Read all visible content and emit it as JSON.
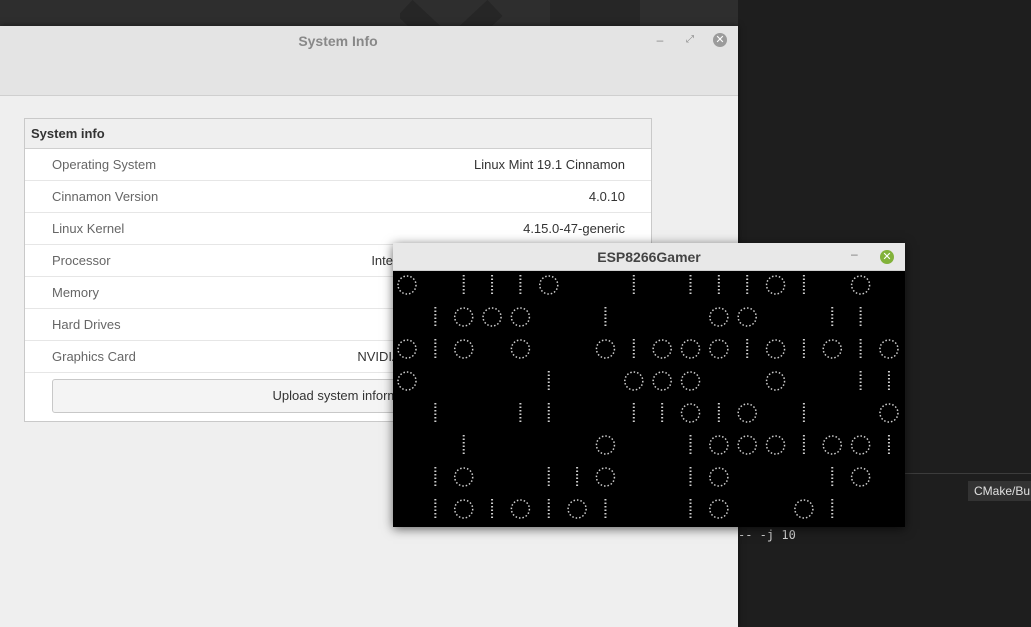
{
  "system_info_window": {
    "title": "System Info",
    "panel_header": "System info",
    "rows": [
      {
        "label": "Operating System",
        "value": "Linux Mint 19.1 Cinnamon"
      },
      {
        "label": "Cinnamon Version",
        "value": "4.0.10"
      },
      {
        "label": "Linux Kernel",
        "value": "4.15.0-47-generic"
      },
      {
        "label": "Processor",
        "value": "Inte"
      },
      {
        "label": "Memory",
        "value": ""
      },
      {
        "label": "Hard Drives",
        "value": ""
      },
      {
        "label": "Graphics Card",
        "value": "NVIDIA C"
      }
    ],
    "upload_button": "Upload system informa",
    "controls": {
      "minimize": "–",
      "maximize": "⤢",
      "close": "✕"
    }
  },
  "esp_window": {
    "title": "ESP8266Gamer",
    "controls": {
      "minimize": "–",
      "close": "✕"
    },
    "screen_rows": [
      "0.1110..1.11101.0",
      ".1000..1...00..11.",
      "010.0..01000101010",
      "0....1..000..0..11",
      ".1..11..11010.1..01",
      "..1....0..10001001",
      ".10..110..10...10.1",
      ".1010101..10..01..1"
    ]
  },
  "terminal": {
    "tab_label": "CMake/Bu",
    "command_fragment": "-- -j 10"
  },
  "colors": {
    "close_button_active": "#82b23a",
    "close_button_inactive": "#9b9b9b",
    "terminal_bg": "#1e1e1e"
  }
}
